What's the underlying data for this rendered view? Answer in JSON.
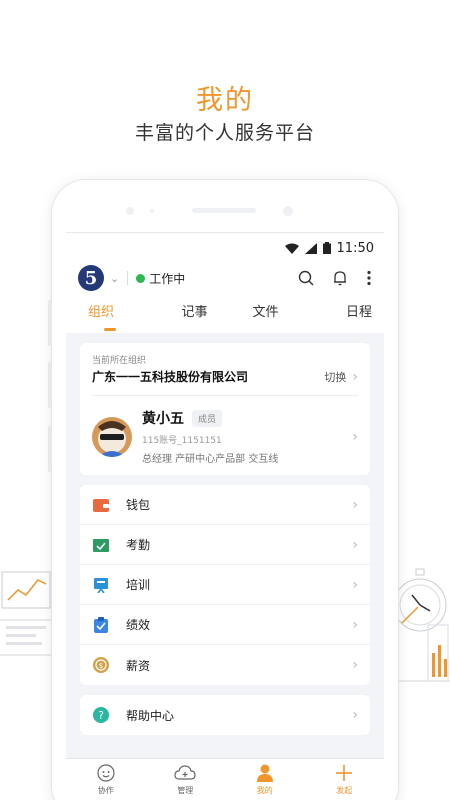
{
  "promo": {
    "title": "我的",
    "subtitle": "丰富的个人服务平台"
  },
  "statusbar": {
    "time": "11:50"
  },
  "topbar": {
    "logo_text": "5",
    "status_label": "工作中",
    "status_color": "#2cb84f"
  },
  "tabs": [
    {
      "label": "组织",
      "active": true
    },
    {
      "label": "记事",
      "active": false
    },
    {
      "label": "文件",
      "active": false
    },
    {
      "label": "日程",
      "active": false
    }
  ],
  "org": {
    "current_label": "当前所在组织",
    "name": "广东一一五科技股份有限公司",
    "switch_label": "切换"
  },
  "user": {
    "name": "黄小五",
    "badge": "成员",
    "account": "115账号_1151151",
    "role": "总经理 产研中心产品部 交互线"
  },
  "menu": [
    {
      "label": "钱包",
      "icon": "wallet-icon",
      "color": "#e86a3f"
    },
    {
      "label": "考勤",
      "icon": "attendance-icon",
      "color": "#2e9b63"
    },
    {
      "label": "培训",
      "icon": "training-icon",
      "color": "#2c92d8"
    },
    {
      "label": "绩效",
      "icon": "performance-icon",
      "color": "#3b86e0"
    },
    {
      "label": "薪资",
      "icon": "salary-icon",
      "color": "#d4a04a"
    }
  ],
  "menu2": [
    {
      "label": "帮助中心",
      "icon": "help-icon",
      "color": "#2ab6a0"
    }
  ],
  "nav": [
    {
      "label": "协作",
      "icon": "collab-icon",
      "active": false
    },
    {
      "label": "管理",
      "icon": "manage-icon",
      "active": false
    },
    {
      "label": "我的",
      "icon": "me-icon",
      "active": true
    },
    {
      "label": "发起",
      "icon": "create-icon",
      "active": false
    }
  ],
  "colors": {
    "accent": "#f0962c",
    "brand": "#243a78"
  }
}
